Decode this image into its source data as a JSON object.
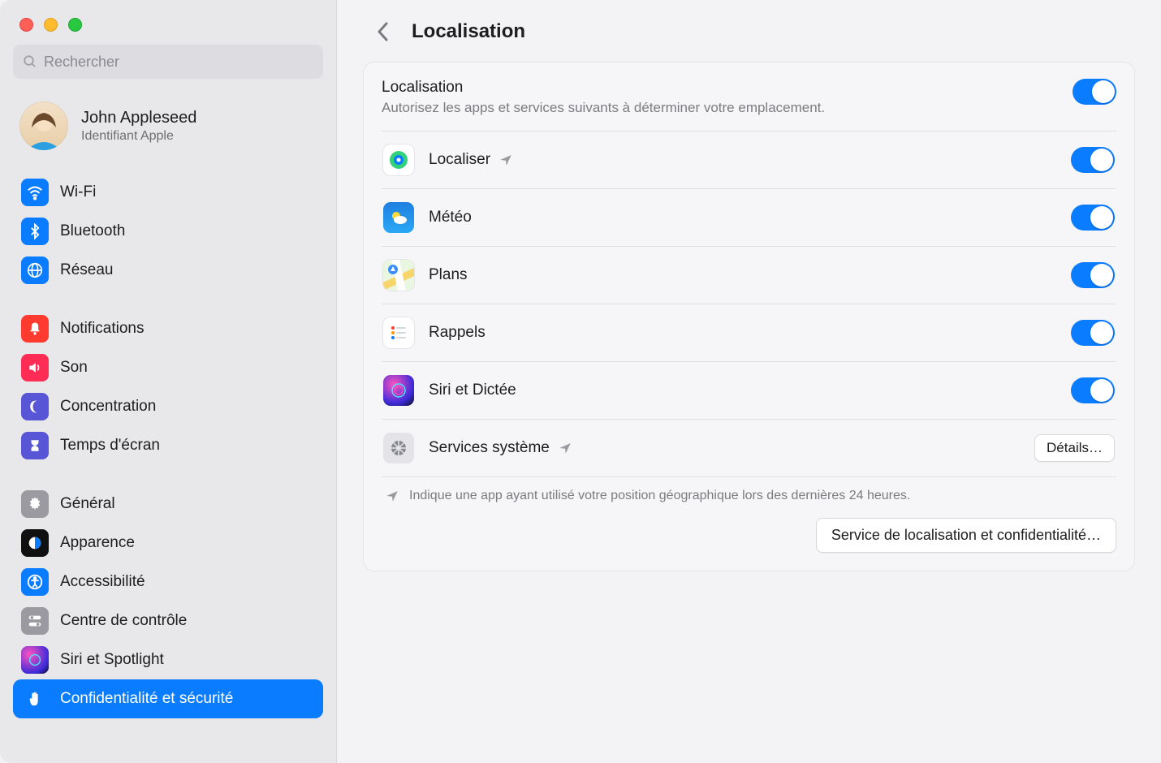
{
  "search": {
    "placeholder": "Rechercher"
  },
  "profile": {
    "name": "John Appleseed",
    "subtitle": "Identifiant Apple"
  },
  "sidebar": {
    "groups": [
      {
        "items": [
          {
            "label": "Wi-Fi",
            "icon": "wifi",
            "bg": "#0a7cff"
          },
          {
            "label": "Bluetooth",
            "icon": "bluetooth",
            "bg": "#0a7cff"
          },
          {
            "label": "Réseau",
            "icon": "network",
            "bg": "#0a7cff"
          }
        ]
      },
      {
        "items": [
          {
            "label": "Notifications",
            "icon": "bell",
            "bg": "#ff3b30"
          },
          {
            "label": "Son",
            "icon": "speaker",
            "bg": "#ff2d55"
          },
          {
            "label": "Concentration",
            "icon": "moon",
            "bg": "#5856d6"
          },
          {
            "label": "Temps d'écran",
            "icon": "hourglass",
            "bg": "#5856d6"
          }
        ]
      },
      {
        "items": [
          {
            "label": "Général",
            "icon": "gear",
            "bg": "#9a9aa0"
          },
          {
            "label": "Apparence",
            "icon": "appearance",
            "bg": "#101010"
          },
          {
            "label": "Accessibilité",
            "icon": "accessibility",
            "bg": "#0a7cff"
          },
          {
            "label": "Centre de contrôle",
            "icon": "control",
            "bg": "#9a9aa0"
          },
          {
            "label": "Siri et Spotlight",
            "icon": "siri",
            "bg": "linear"
          },
          {
            "label": "Confidentialité et sécurité",
            "icon": "hand",
            "bg": "#0a7cff",
            "active": true
          }
        ]
      }
    ]
  },
  "header": {
    "title": "Localisation"
  },
  "panel": {
    "title": "Localisation",
    "desc": "Autorisez les apps et services suivants à déterminer votre emplacement.",
    "master_toggle": true,
    "rows": [
      {
        "label": "Localiser",
        "icon": "findmy",
        "arrow": true,
        "toggle": true
      },
      {
        "label": "Météo",
        "icon": "weather",
        "arrow": false,
        "toggle": true
      },
      {
        "label": "Plans",
        "icon": "maps",
        "arrow": false,
        "toggle": true
      },
      {
        "label": "Rappels",
        "icon": "reminders",
        "arrow": false,
        "toggle": true
      },
      {
        "label": "Siri et Dictée",
        "icon": "siri",
        "arrow": false,
        "toggle": true
      },
      {
        "label": "Services système",
        "icon": "systemgear",
        "arrow": true,
        "button": "Détails…"
      }
    ],
    "legend": "Indique une app ayant utilisé votre position géographique lors des dernières 24 heures.",
    "footer_button": "Service de localisation et confidentialité…"
  }
}
